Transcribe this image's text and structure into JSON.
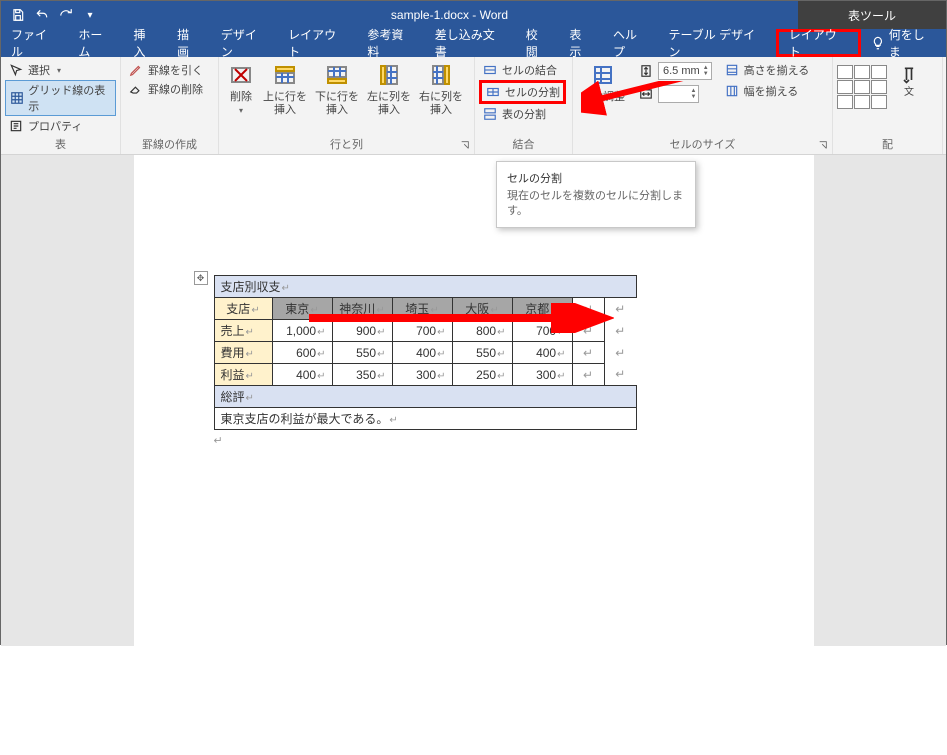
{
  "titlebar": {
    "doc_title": "sample-1.docx - Word",
    "tool_context": "表ツール"
  },
  "tabs": {
    "file": "ファイル",
    "home": "ホーム",
    "insert": "挿入",
    "draw": "描画",
    "design": "デザイン",
    "layout": "レイアウト",
    "ref": "参考資料",
    "mail": "差し込み文書",
    "review": "校閲",
    "view": "表示",
    "help": "ヘルプ",
    "table_design": "テーブル デザイン",
    "table_layout": "レイアウト",
    "tell": "何をしま"
  },
  "grp_table": {
    "label": "表",
    "select": "選択",
    "gridlines": "グリッド線の表示",
    "props": "プロパティ"
  },
  "grp_draw": {
    "label": "罫線の作成",
    "draw": "罫線を引く",
    "erase": "罫線の削除"
  },
  "grp_rc": {
    "label": "行と列",
    "delete": "削除",
    "ins_above": "上に行を\n挿入",
    "ins_below": "下に行を\n挿入",
    "ins_left": "左に列を\n挿入",
    "ins_right": "右に列を\n挿入"
  },
  "grp_merge": {
    "label": "結合",
    "merge": "セルの結合",
    "split": "セルの分割",
    "split_table": "表の分割"
  },
  "grp_size": {
    "label": "セルのサイズ",
    "autofit": "自動調整",
    "height": "6.5 mm",
    "fit_h": "高さを揃える",
    "fit_w": "幅を揃える"
  },
  "grp_align": {
    "label": "配"
  },
  "tooltip": {
    "title": "セルの分割",
    "body": "現在のセルを複数のセルに分割します。"
  },
  "wtable": {
    "title": "支店別収支",
    "cols": [
      "支店",
      "東京",
      "神奈川",
      "埼玉",
      "大阪",
      "京都"
    ],
    "rows": [
      {
        "hdr": "売上",
        "vals": [
          "1,000",
          "900",
          "700",
          "800",
          "700"
        ]
      },
      {
        "hdr": "費用",
        "vals": [
          "600",
          "550",
          "400",
          "550",
          "400"
        ]
      },
      {
        "hdr": "利益",
        "vals": [
          "400",
          "350",
          "300",
          "250",
          "300"
        ]
      }
    ],
    "summary_hdr": "総評",
    "summary_body": "東京支店の利益が最大である。"
  }
}
